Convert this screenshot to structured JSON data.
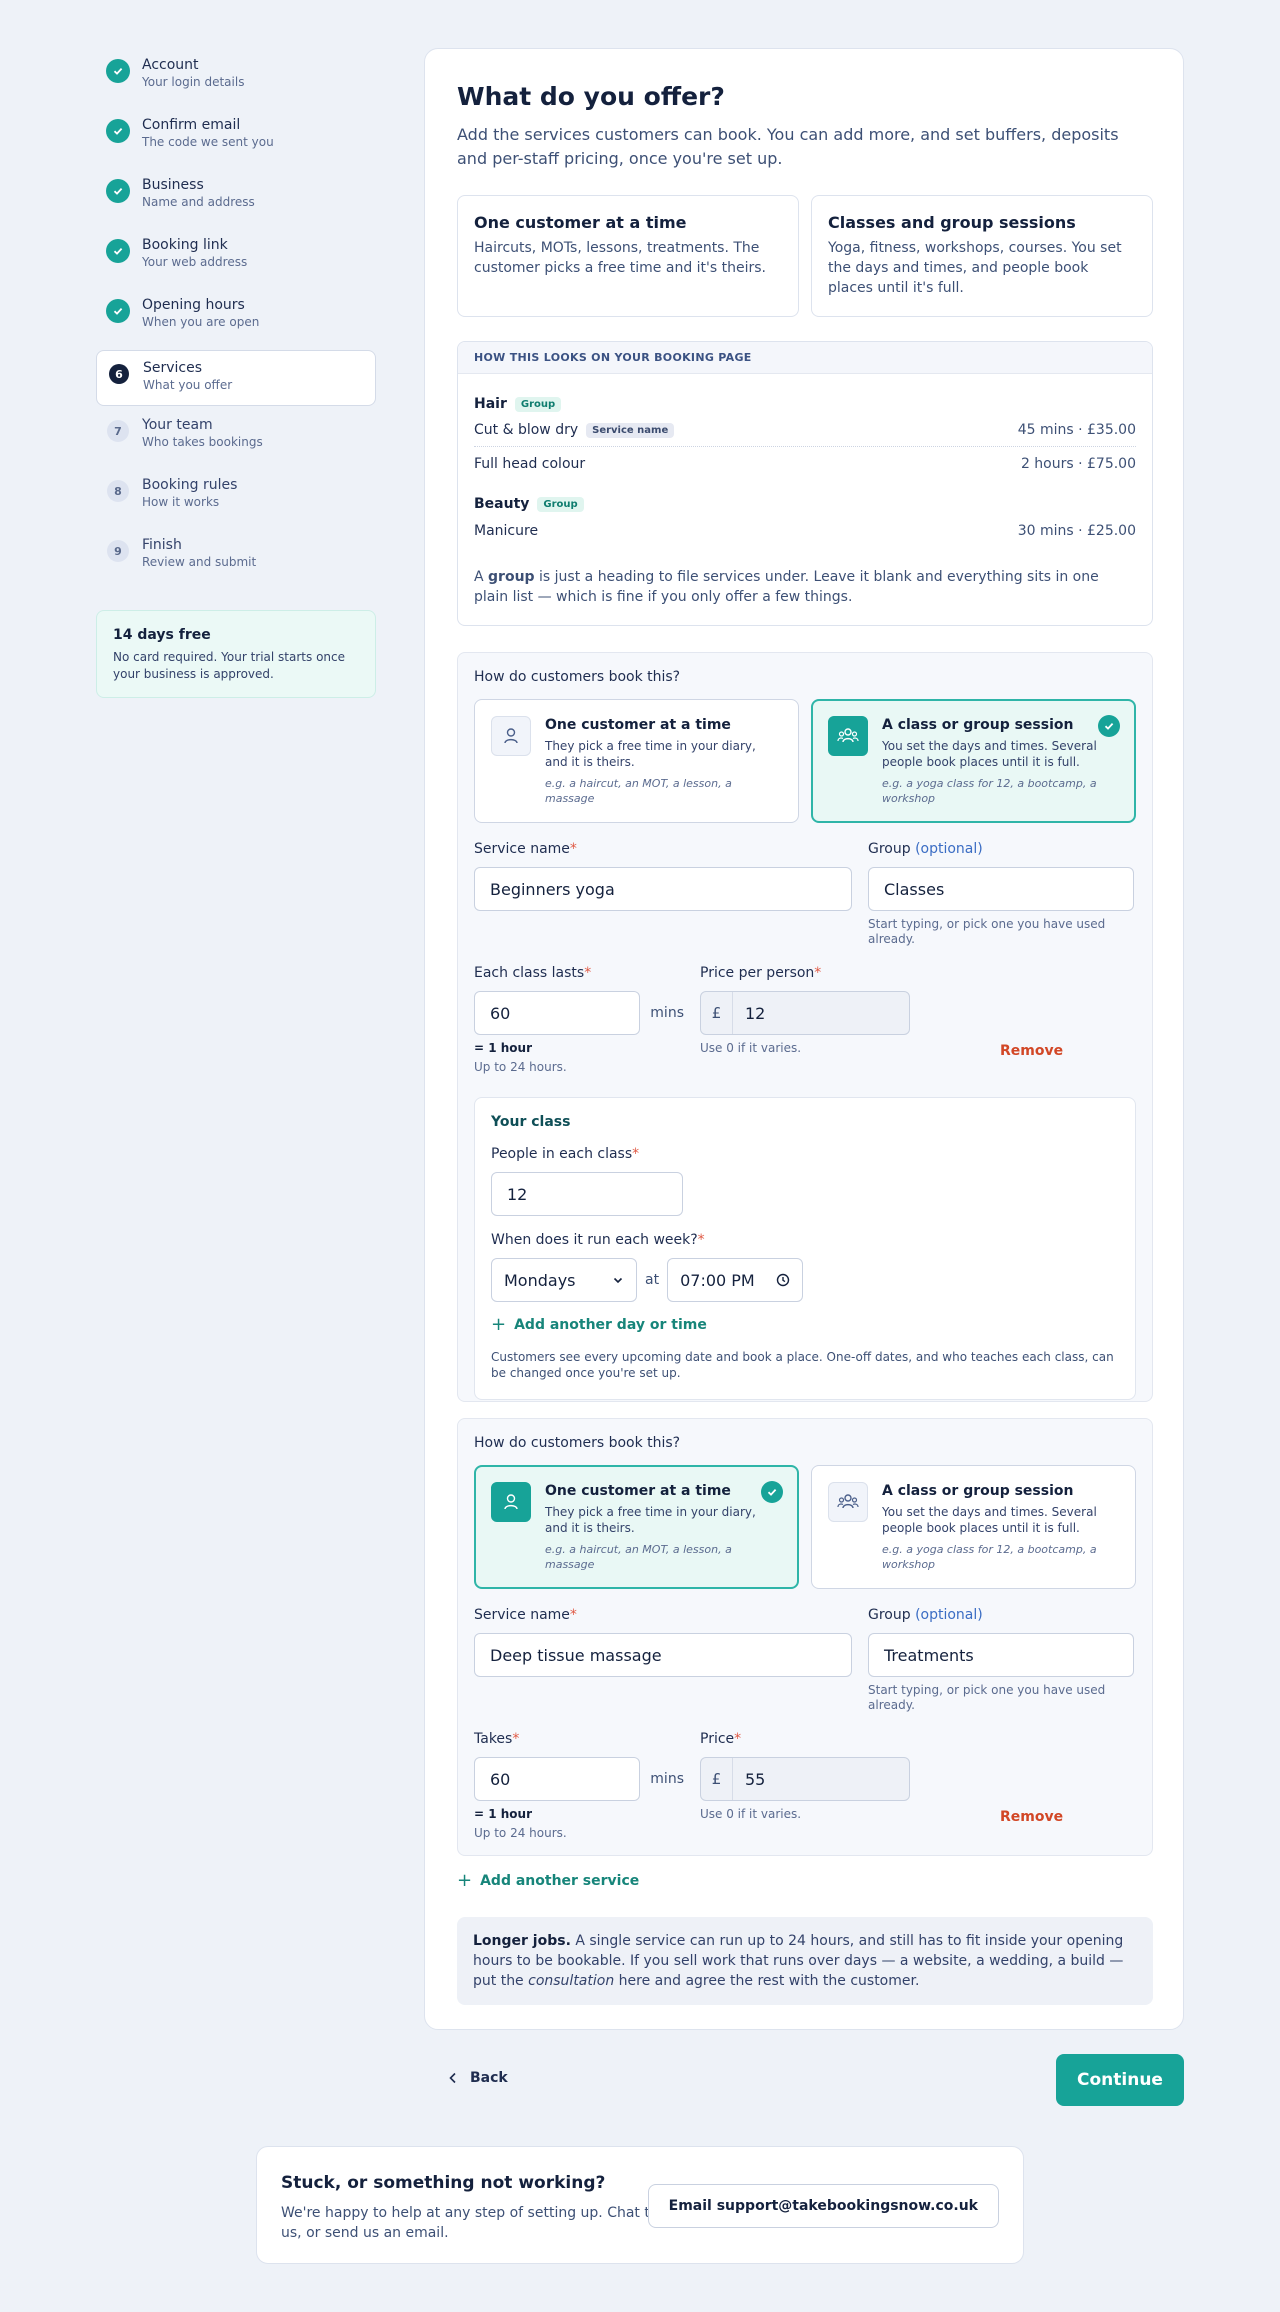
{
  "steps": [
    {
      "num": "",
      "title": "Account",
      "sub": "Your login details",
      "state": "done"
    },
    {
      "num": "",
      "title": "Confirm email",
      "sub": "The code we sent you",
      "state": "done"
    },
    {
      "num": "",
      "title": "Business",
      "sub": "Name and address",
      "state": "done"
    },
    {
      "num": "",
      "title": "Booking link",
      "sub": "Your web address",
      "state": "done"
    },
    {
      "num": "",
      "title": "Opening hours",
      "sub": "When you are open",
      "state": "done"
    },
    {
      "num": "6",
      "title": "Services",
      "sub": "What you offer",
      "state": "current"
    },
    {
      "num": "7",
      "title": "Your team",
      "sub": "Who takes bookings",
      "state": "todo"
    },
    {
      "num": "8",
      "title": "Booking rules",
      "sub": "How it works",
      "state": "todo"
    },
    {
      "num": "9",
      "title": "Finish",
      "sub": "Review and submit",
      "state": "todo"
    }
  ],
  "trial": {
    "title": "14 days free",
    "text": "No card required. Your trial starts once your business is approved."
  },
  "page": {
    "title": "What do you offer?",
    "lead": "Add the services customers can book. You can add more, and set buffers, deposits and per-staff pricing, once you're set up."
  },
  "types": [
    {
      "title": "One customer at a time",
      "text": "Haircuts, MOTs, lessons, treatments. The customer picks a free time and it's theirs."
    },
    {
      "title": "Classes and group sessions",
      "text": "Yoga, fitness, workshops, courses. You set the days and times, and people book places until it's full."
    }
  ],
  "preview": {
    "heading": "HOW THIS LOOKS ON YOUR BOOKING PAGE",
    "group_chip": "Group",
    "service_chip": "Service name",
    "groups": [
      {
        "name": "Hair",
        "rows": [
          {
            "name": "Cut & blow dry",
            "meta": "45 mins · £35.00"
          },
          {
            "name": "Full head colour",
            "meta": "2 hours · £75.00"
          }
        ]
      },
      {
        "name": "Beauty",
        "rows": [
          {
            "name": "Manicure",
            "meta": "30 mins · £25.00"
          }
        ]
      }
    ],
    "note_a": "A ",
    "note_b": "group",
    "note_c": " is just a heading to file services under. Leave it blank and everything sits in one plain list — which is fine if you only offer a few things."
  },
  "booking": {
    "question": "How do customers book this?",
    "one": {
      "title": "One customer at a time",
      "text": "They pick a free time in your diary, and it is theirs.",
      "example": "e.g. a haircut, an MOT, a lesson, a massage"
    },
    "class": {
      "title": "A class or group session",
      "text": "You set the days and times. Several people book places until it is full.",
      "example": "e.g. a yoga class for 12, a bootcamp, a workshop"
    }
  },
  "labels": {
    "service_name": "Service name",
    "group": "Group",
    "optional": "(optional)",
    "req": "*",
    "group_hint": "Start typing, or pick one you have used already.",
    "class_lasts": "Each class lasts",
    "takes": "Takes",
    "price_person": "Price per person",
    "price": "Price",
    "mins": "mins",
    "currency": "£",
    "dur_hint_b": "= 1 hour",
    "dur_hint": "Up to 24 hours.",
    "price_hint": "Use 0 if it varies.",
    "remove": "Remove",
    "at": "at"
  },
  "service1": {
    "name": "Beginners yoga",
    "group": "Classes",
    "duration": "60",
    "price": "12",
    "class": {
      "title": "Your class",
      "people_label": "People in each class",
      "people": "12",
      "when_label": "When does it run each week?",
      "day": "Mondays",
      "time": "07:00 PM",
      "add": "Add another day or time",
      "note": "Customers see every upcoming date and book a place. One-off dates, and who teaches each class, can be changed once you're set up."
    }
  },
  "service2": {
    "name": "Deep tissue massage",
    "group": "Treatments",
    "duration": "60",
    "price": "55"
  },
  "add_service": "Add another service",
  "longer": {
    "bold": "Longer jobs.",
    "text_a": " A single service can run up to 24 hours, and still has to fit inside your opening hours to be bookable. If you sell work that runs over days — a website, a wedding, a build — put the ",
    "ital": "consultation",
    "text_b": " here and agree the rest with the customer."
  },
  "nav": {
    "back": "Back",
    "continue": "Continue"
  },
  "help": {
    "title": "Stuck, or something not working?",
    "text": "We're happy to help at any step of setting up. Chat to us, or send us an email.",
    "button": "Email support@takebookingsnow.co.uk"
  },
  "colors": {
    "accent": "#17a398",
    "danger": "#d24726",
    "navy": "#14213d"
  }
}
